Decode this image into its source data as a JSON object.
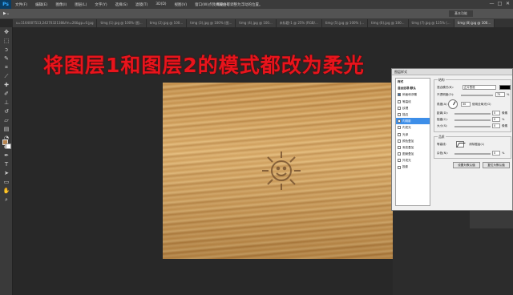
{
  "app": {
    "logo": "Ps",
    "window_title": "点我并按住可调整为浮动的位置。"
  },
  "menu": [
    "文件(F)",
    "编辑(E)",
    "图像(I)",
    "图层(L)",
    "文字(Y)",
    "选择(S)",
    "滤镜(T)",
    "3D(D)",
    "视图(V)",
    "窗口(W)",
    "帮助(H)"
  ],
  "window_controls": [
    "—",
    "□",
    "✕"
  ],
  "options_bar": {
    "tool_label": "▶⌄",
    "right_label": "基本功能"
  },
  "tabs": [
    {
      "label": "u=1164007513,2427032138&fm=26&gp=0.jpg",
      "active": false
    },
    {
      "label": "timg (1).jpg @ 100% (图...",
      "active": false
    },
    {
      "label": "timg (2).jpg @ 100...",
      "active": false
    },
    {
      "label": "timg (3).jpg @ 100% (图...",
      "active": false
    },
    {
      "label": "timg (4).jpg @ 100...",
      "active": false
    },
    {
      "label": "未标题-1 @ 25% (RGB/...",
      "active": false
    },
    {
      "label": "timg (5).jpg @ 100% (...",
      "active": false
    },
    {
      "label": "timg (6).jpg @ 100...",
      "active": false
    },
    {
      "label": "timg (7).jpg @ 125% (...",
      "active": false
    },
    {
      "label": "timg (8).jpg @ 100...",
      "active": true
    }
  ],
  "caption": "将图层1和图层2的模式都改为柔光",
  "colors": {
    "caption": "#e8141c",
    "foreground_swatch": "#b8854f",
    "background_swatch": "#ffffff",
    "selection": "#3d8ee8"
  },
  "tools": [
    "move-icon",
    "marquee-icon",
    "lasso-icon",
    "quick-select-icon",
    "crop-icon",
    "eyedropper-icon",
    "healing-icon",
    "brush-icon",
    "stamp-icon",
    "history-brush-icon",
    "eraser-icon",
    "gradient-icon",
    "blur-icon",
    "dodge-icon",
    "pen-icon",
    "type-icon",
    "path-select-icon",
    "shape-icon",
    "hand-icon",
    "zoom-icon"
  ],
  "dialog": {
    "title": "图层样式",
    "styles": [
      {
        "label": "样式",
        "checked": false,
        "header": true,
        "selected": false
      },
      {
        "label": "混合选项:默认",
        "checked": false,
        "header": true,
        "selected": false
      },
      {
        "label": "斜面和浮雕",
        "checked": true,
        "header": false,
        "selected": false
      },
      {
        "label": "等高线",
        "checked": false,
        "header": false,
        "selected": false
      },
      {
        "label": "纹理",
        "checked": false,
        "header": false,
        "selected": false
      },
      {
        "label": "描边",
        "checked": false,
        "header": false,
        "selected": false
      },
      {
        "label": "内阴影",
        "checked": false,
        "header": false,
        "selected": true
      },
      {
        "label": "内发光",
        "checked": false,
        "header": false,
        "selected": false
      },
      {
        "label": "光泽",
        "checked": false,
        "header": false,
        "selected": false
      },
      {
        "label": "颜色叠加",
        "checked": false,
        "header": false,
        "selected": false
      },
      {
        "label": "渐变叠加",
        "checked": false,
        "header": false,
        "selected": false
      },
      {
        "label": "图案叠加",
        "checked": false,
        "header": false,
        "selected": false
      },
      {
        "label": "外发光",
        "checked": false,
        "header": false,
        "selected": false
      },
      {
        "label": "投影",
        "checked": false,
        "header": false,
        "selected": false
      }
    ],
    "structure_title": "结构",
    "blend_mode_label": "混合模式(B):",
    "blend_mode_value": "正片叠底",
    "opacity_label": "不透明度(O):",
    "opacity_value": "75",
    "angle_label": "角度(A):",
    "angle_value": "30",
    "global_light_label": "使用全局光(G)",
    "distance_label": "距离(D):",
    "distance_value": "0",
    "choke_label": "阻塞(C):",
    "choke_value": "0",
    "size_label": "大小(S):",
    "size_value": "0",
    "unit_px": "像素",
    "unit_pct": "%",
    "quality_title": "品质",
    "contour_label": "等高线:",
    "antialias_label": "消除锯齿(L)",
    "noise_label": "杂色(N):",
    "noise_value": "0",
    "default_button": "设置为默认值",
    "reset_button": "复位为默认值"
  }
}
